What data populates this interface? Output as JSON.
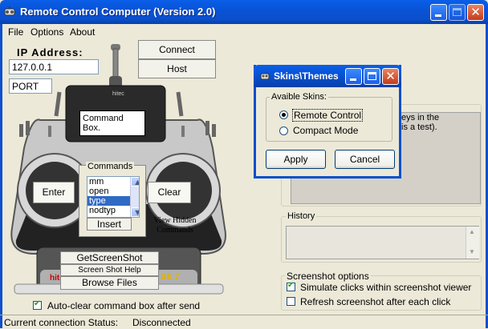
{
  "window": {
    "title": "Remote Control Computer (Version 2.0)"
  },
  "menu": [
    "File",
    "Options",
    "About"
  ],
  "connection": {
    "ip_label": "IP Address:",
    "ip_value": "127.0.0.1",
    "port_value": "PORT",
    "connect_label": "Connect",
    "host_label": "Host"
  },
  "remote": {
    "brand": "hitec",
    "screen_text": "Command Box.",
    "enter_label": "Enter",
    "clear_label": "Clear",
    "commands_title": "Commands",
    "commands": [
      "mm",
      "open",
      "type",
      "nodtyp"
    ],
    "selected_command": "type",
    "insert_label": "Insert",
    "view_hidden_label": "View Hidden Commands",
    "getscreenshot_label": "GetScreenShot",
    "screenshot_help_label": "Screen Shot Help",
    "browse_files_label": "Browse Files",
    "model_badge": "SE 7",
    "brand_badge": "hite"
  },
  "autoclear": {
    "label": "Auto-clear command box after send",
    "checked": true
  },
  "info_box": {
    "text_line1": "eys in the",
    "text_line2": "is a test)."
  },
  "history": {
    "title": "History"
  },
  "screenshot_options": {
    "title": "Screenshot options",
    "simulate_label": "Simulate clicks within screenshot viewer",
    "simulate_checked": true,
    "refresh_label": "Refresh screenshot after each click",
    "refresh_checked": false
  },
  "status": {
    "label": "Current connection Status:",
    "value": "Disconnected"
  },
  "dialog": {
    "title": "Skins\\Themes",
    "group_title": "Avaible Skins:",
    "options": [
      "Remote Control",
      "Compact Mode"
    ],
    "selected": "Remote Control",
    "apply_label": "Apply",
    "cancel_label": "Cancel"
  },
  "colors": {
    "titlebar_blue": "#0a4fcc",
    "selection_blue": "#316ac5",
    "close_red": "#c53b1c",
    "window_bg": "#ece9d8"
  }
}
